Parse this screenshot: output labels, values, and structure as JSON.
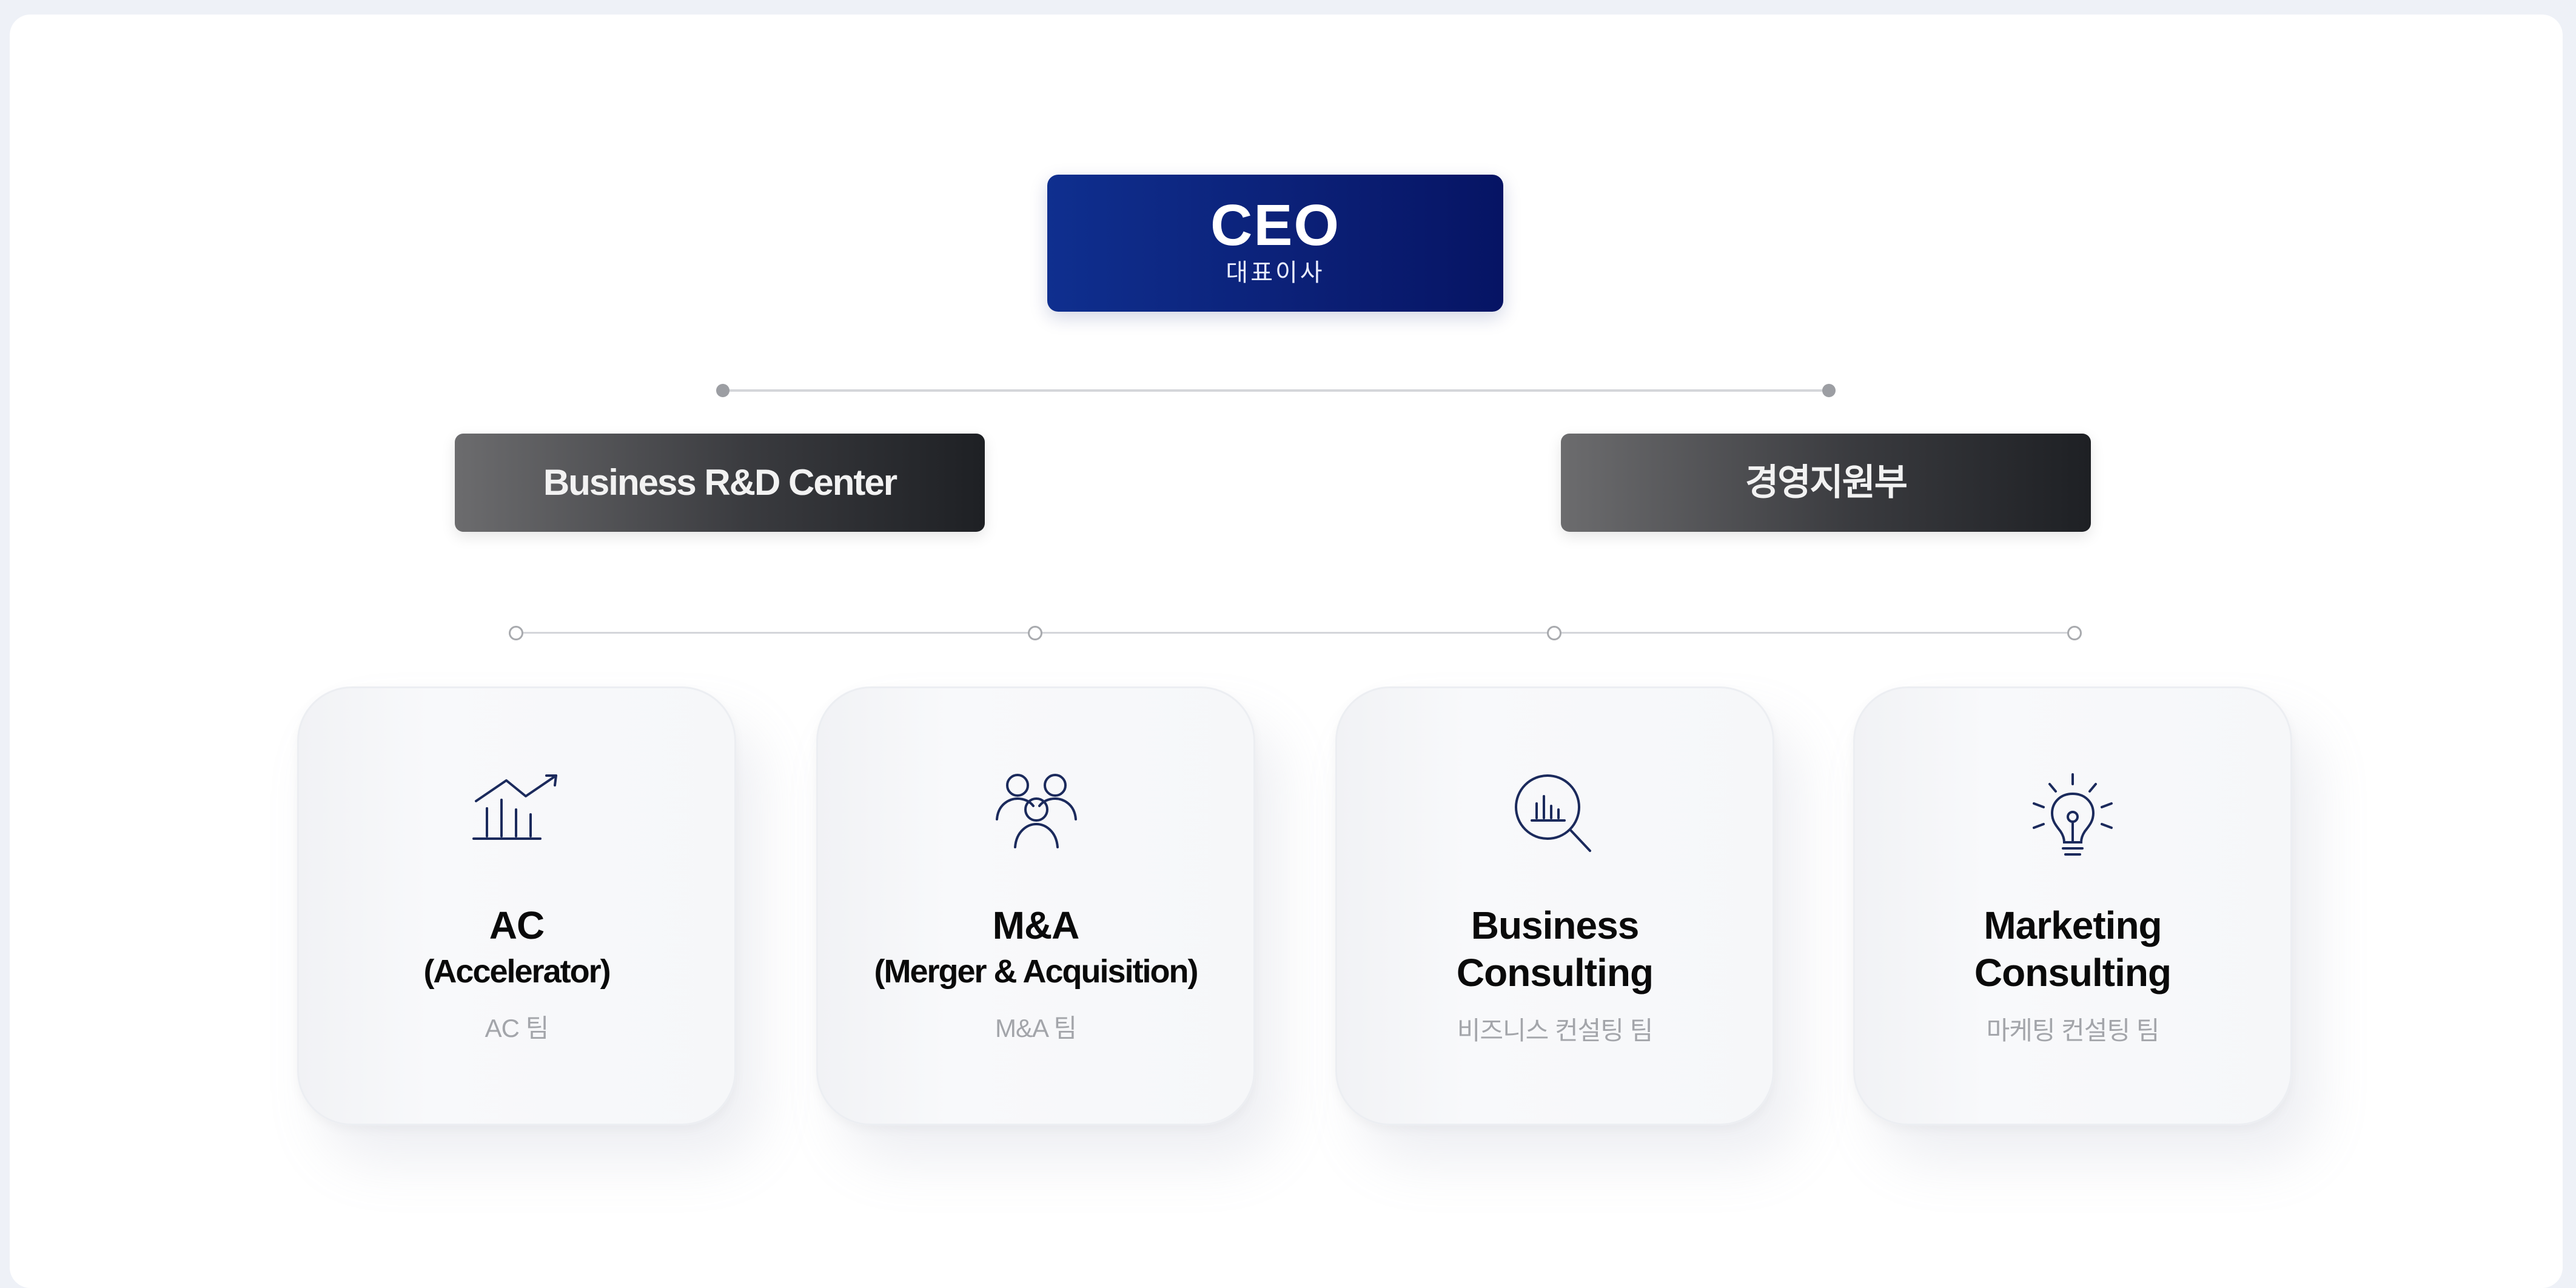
{
  "ceo": {
    "title": "CEO",
    "subtitle": "대표이사"
  },
  "departments": [
    {
      "label": "Business R&D Center"
    },
    {
      "label": "경영지원부"
    }
  ],
  "teams": [
    {
      "title_line1": "AC",
      "title_line2": "(Accelerator)",
      "subtitle": "AC 팀",
      "icon": "growth-chart-icon"
    },
    {
      "title_line1": "M&A",
      "title_line2": "(Merger & Acquisition)",
      "subtitle": "M&A 팀",
      "icon": "people-group-icon"
    },
    {
      "title_line1": "Business",
      "title_line2": "Consulting",
      "subtitle": "비즈니스 컨설팅 팀",
      "icon": "magnifier-chart-icon"
    },
    {
      "title_line1": "Marketing",
      "title_line2": "Consulting",
      "subtitle": "마케팅 컨설팅 팀",
      "icon": "lightbulb-icon"
    }
  ],
  "colors": {
    "ceo_box": "#0b1f75",
    "department_bar": "#3a3b3f",
    "icon_stroke": "#1b2a5c",
    "background": "#eef1f7"
  }
}
